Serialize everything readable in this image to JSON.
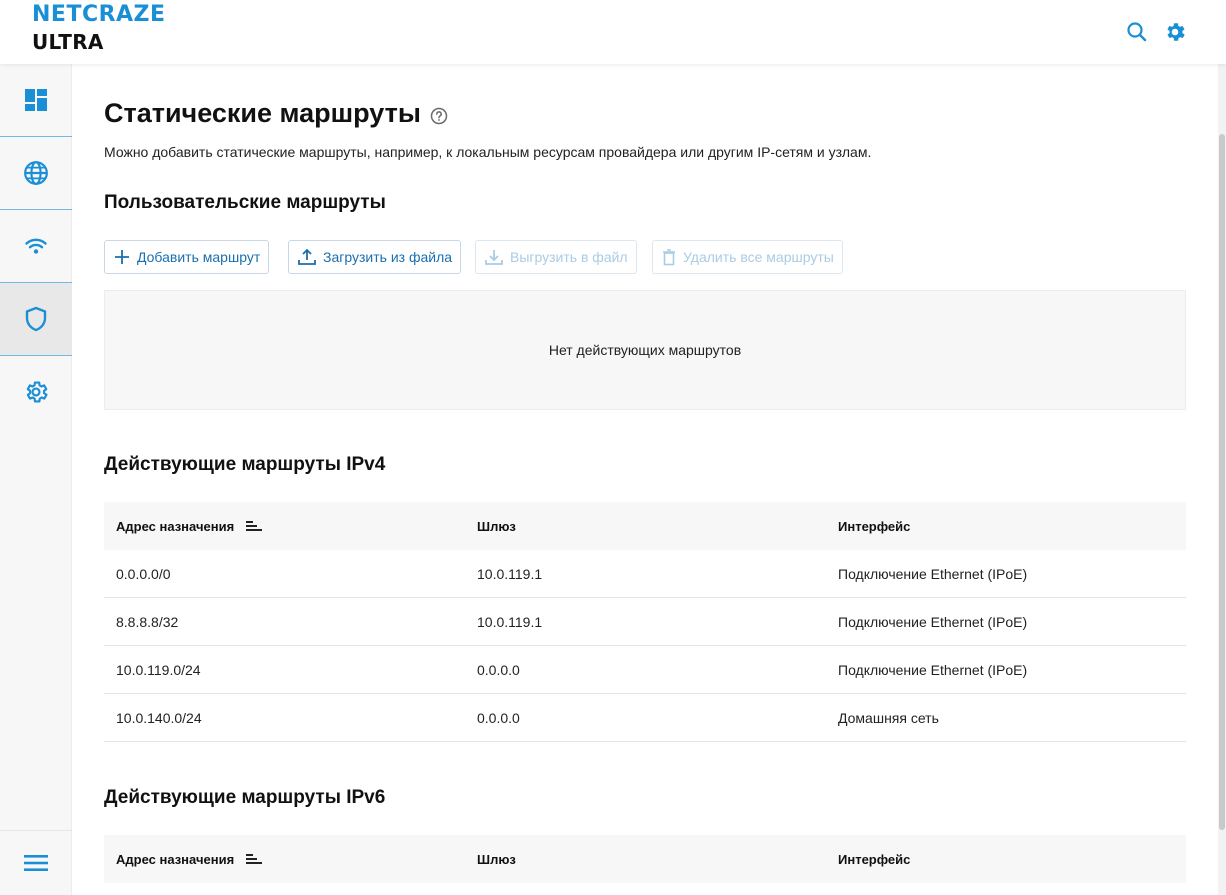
{
  "brand": {
    "line1": "NETCRAZE",
    "line2": "ULTRA"
  },
  "header_icons": [
    "search-icon",
    "gear-icon"
  ],
  "sidebar": {
    "items": [
      {
        "name": "dashboard",
        "icon": "dashboard-icon"
      },
      {
        "name": "internet",
        "icon": "globe-icon"
      },
      {
        "name": "wifi",
        "icon": "wifi-icon"
      },
      {
        "name": "security",
        "icon": "shield-icon",
        "active": true
      },
      {
        "name": "settings",
        "icon": "gear-icon"
      }
    ],
    "menu_icon": "hamburger-icon"
  },
  "page": {
    "title": "Статические маршруты",
    "description": "Можно добавить статические маршруты, например, к локальным ресурсам провайдера или другим IP-сетям и узлам."
  },
  "user_routes": {
    "title": "Пользовательские маршруты",
    "buttons": {
      "add": "Добавить маршрут",
      "upload": "Загрузить из файла",
      "download": "Выгрузить в файл",
      "delete_all": "Удалить все маршруты"
    },
    "empty": "Нет действующих маршрутов"
  },
  "ipv4": {
    "title": "Действующие маршруты IPv4",
    "columns": {
      "destination": "Адрес назначения",
      "gateway": "Шлюз",
      "interface": "Интерфейс"
    },
    "rows": [
      {
        "destination": "0.0.0.0/0",
        "gateway": "10.0.119.1",
        "interface": "Подключение Ethernet (IPoE)"
      },
      {
        "destination": "8.8.8.8/32",
        "gateway": "10.0.119.1",
        "interface": "Подключение Ethernet (IPoE)"
      },
      {
        "destination": "10.0.119.0/24",
        "gateway": "0.0.0.0",
        "interface": "Подключение Ethernet (IPoE)"
      },
      {
        "destination": "10.0.140.0/24",
        "gateway": "0.0.0.0",
        "interface": "Домашняя сеть"
      }
    ]
  },
  "ipv6": {
    "title": "Действующие маршруты IPv6",
    "columns": {
      "destination": "Адрес назначения",
      "gateway": "Шлюз",
      "interface": "Интерфейс"
    }
  },
  "colors": {
    "accent": "#1a8fd6",
    "link": "#1a6fae",
    "disabled": "#a9cce4"
  }
}
